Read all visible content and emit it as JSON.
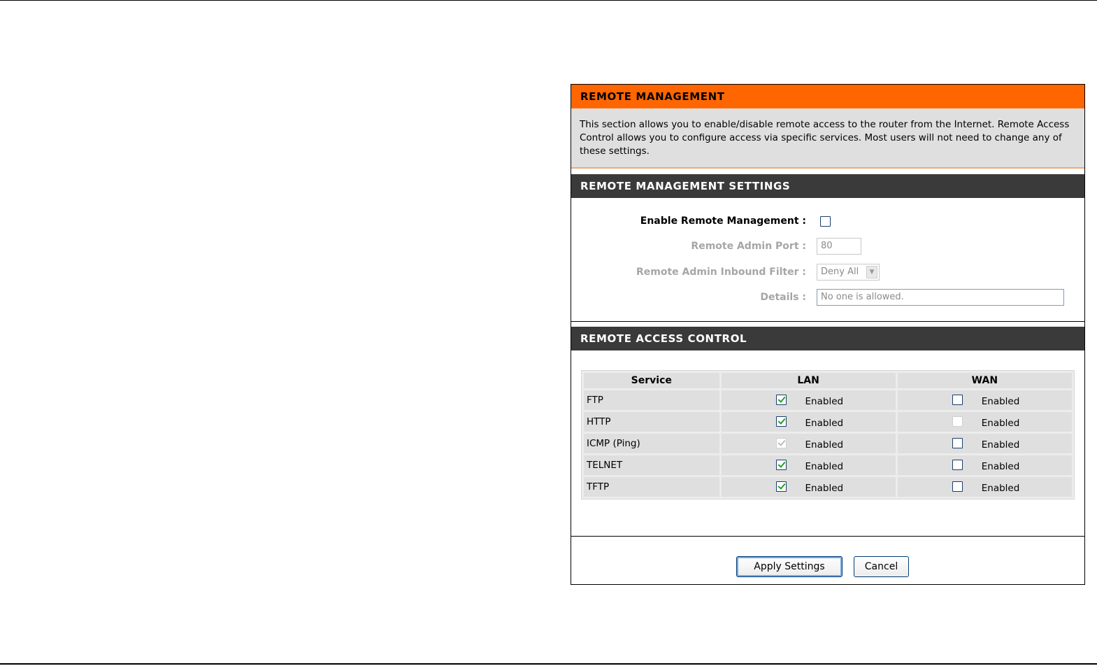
{
  "remote_management": {
    "title": "REMOTE MANAGEMENT",
    "description": "This section allows you to enable/disable remote access to the router from the Internet. Remote Access Control allows you to configure access via specific services. Most users will not need to change any of these settings."
  },
  "settings": {
    "title": "REMOTE MANAGEMENT SETTINGS",
    "enable_label": "Enable Remote Management :",
    "enable_checked": false,
    "port_label": "Remote Admin Port :",
    "port_value": "80",
    "filter_label": "Remote Admin Inbound Filter :",
    "filter_value": "Deny All",
    "details_label": "Details :",
    "details_value": "No one is allowed."
  },
  "access_control": {
    "title": "REMOTE ACCESS CONTROL",
    "headers": [
      "Service",
      "LAN",
      "WAN"
    ],
    "enabled_label": "Enabled",
    "rows": [
      {
        "service": "FTP",
        "lan_checked": true,
        "lan_disabled": false,
        "wan_checked": false,
        "wan_disabled": false
      },
      {
        "service": "HTTP",
        "lan_checked": true,
        "lan_disabled": false,
        "wan_checked": false,
        "wan_disabled": true
      },
      {
        "service": "ICMP (Ping)",
        "lan_checked": true,
        "lan_disabled": true,
        "wan_checked": false,
        "wan_disabled": false
      },
      {
        "service": "TELNET",
        "lan_checked": true,
        "lan_disabled": false,
        "wan_checked": false,
        "wan_disabled": false
      },
      {
        "service": "TFTP",
        "lan_checked": true,
        "lan_disabled": false,
        "wan_checked": false,
        "wan_disabled": false
      }
    ]
  },
  "buttons": {
    "apply": "Apply Settings",
    "cancel": "Cancel"
  },
  "colors": {
    "accent_orange": "#ff6600",
    "header_dark": "#3a3a3a",
    "panel_gray": "#dfdfdf",
    "check_green": "#21a121"
  }
}
